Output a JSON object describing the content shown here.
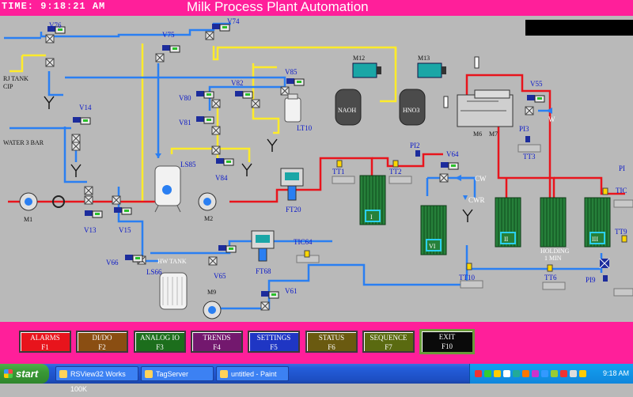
{
  "header": {
    "time_label": "TIME:",
    "time": "9:18:21 AM",
    "title": "Milk Process Plant Automation"
  },
  "valves": [
    "V76",
    "V75",
    "V74",
    "V85",
    "V82",
    "V80",
    "V81",
    "V84",
    "V14",
    "V13",
    "V15",
    "V66",
    "V65",
    "V61",
    "V64",
    "V55"
  ],
  "motors": [
    "M1",
    "M2",
    "M9",
    "M12",
    "M13",
    "M6",
    "M7"
  ],
  "labels": {
    "rj_tank": "RJ TANK",
    "cip": "CIP",
    "water": "WATER 3 BAR",
    "naoh": "NAOH",
    "hno3": "HNO3",
    "lt10": "LT10",
    "ls85": "LS85",
    "ls66": "LS66",
    "hw_tank": "HW TANK",
    "ft20": "FT20",
    "ft68": "FT68",
    "tic64": "TIC64",
    "tt1": "TT1",
    "tt2": "TT2",
    "pi2": "PI2",
    "pi3": "PI3",
    "tt3": "TT3",
    "tt10": "TT10",
    "tt6": "TT6",
    "pi9": "PI9",
    "tt9": "TT9",
    "tic_edge": "TIC",
    "pi_edge": "PI",
    "cw": "CW",
    "cwr": "CWR",
    "w": "W",
    "section_i": "I",
    "section_vi": "VI",
    "section_ii": "II",
    "section_iii": "III",
    "holding": "HOLDING",
    "holding_time": "1 MIN"
  },
  "function_keys": [
    {
      "label": "ALARMS",
      "key": "F1",
      "color": "#e8141c"
    },
    {
      "label": "DI/DO",
      "key": "F2",
      "color": "#8a4e12"
    },
    {
      "label": "ANALOG IO",
      "key": "F3",
      "color": "#1c6e1c"
    },
    {
      "label": "TRENDS",
      "key": "F4",
      "color": "#73186e"
    },
    {
      "label": "SETTINGS",
      "key": "F5",
      "color": "#1f36c4"
    },
    {
      "label": "STATUS",
      "key": "F6",
      "color": "#6a5a10"
    },
    {
      "label": "SEQUENCE",
      "key": "F7",
      "color": "#5a6a10"
    },
    {
      "label": "EXIT",
      "key": "F10",
      "color": "#0a0a0a"
    }
  ],
  "taskbar": {
    "start": "start",
    "items": [
      "RSView32 Works 100K",
      "TagServer",
      "untitled - Paint"
    ],
    "clock": "9:18 AM"
  },
  "colors": {
    "header": "#ff1f9a",
    "background": "#b9b9b9",
    "hot_line": "#e8141c",
    "water_line": "#2a7ff2",
    "yellow_line": "#ffeb2a"
  }
}
